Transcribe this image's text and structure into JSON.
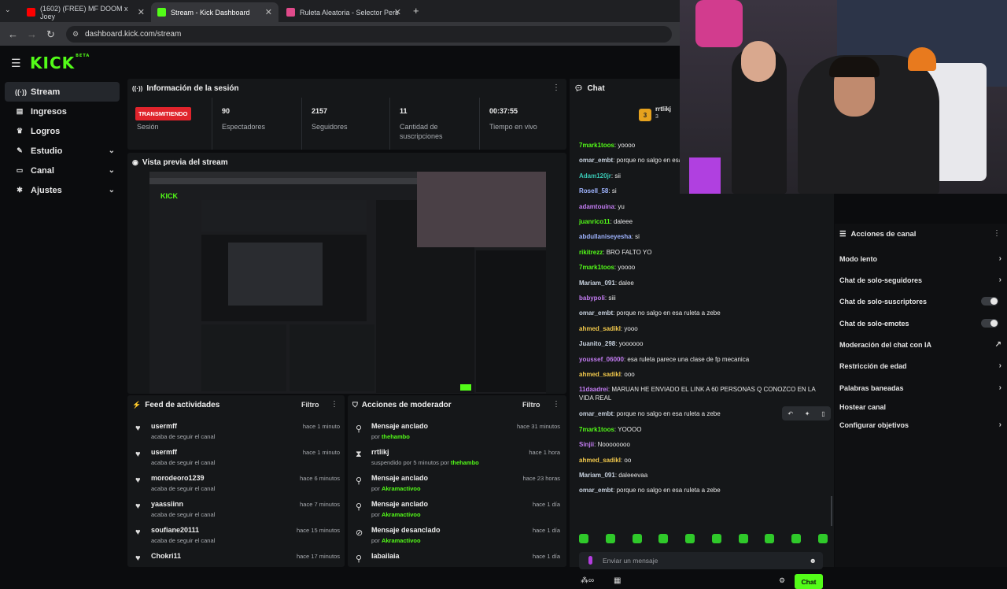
{
  "browser": {
    "tabs": [
      {
        "title": "(1602) (FREE) MF DOOM x Joey",
        "favicon_color": "#ff0000"
      },
      {
        "title": "Stream - Kick Dashboard",
        "favicon_color": "#53fc18"
      },
      {
        "title": "Ruleta Aleatoria - Selector Pers",
        "favicon_color": "#e04a8a"
      }
    ],
    "url": "dashboard.kick.com/stream",
    "new_tab": "+"
  },
  "logo": {
    "text": "KICK",
    "beta": "BETA"
  },
  "sidebar": {
    "items": [
      {
        "label": "Stream",
        "icon": "broadcast-icon",
        "glyph": "((·))",
        "chevron": false
      },
      {
        "label": "Ingresos",
        "icon": "revenue-icon",
        "glyph": "▤",
        "chevron": false
      },
      {
        "label": "Logros",
        "icon": "trophy-icon",
        "glyph": "♛",
        "chevron": false
      },
      {
        "label": "Estudio",
        "icon": "studio-icon",
        "glyph": "✎",
        "chevron": true
      },
      {
        "label": "Canal",
        "icon": "channel-icon",
        "glyph": "▭",
        "chevron": true
      },
      {
        "label": "Ajustes",
        "icon": "gear-icon",
        "glyph": "✱",
        "chevron": true
      }
    ]
  },
  "session": {
    "title": "Información de la sesión",
    "live_badge": "TRANSMITIENDO",
    "stats": [
      {
        "value": "",
        "label": "Sesión"
      },
      {
        "value": "90",
        "label": "Espectadores"
      },
      {
        "value": "2157",
        "label": "Seguidores"
      },
      {
        "value": "11",
        "label": "Cantidad de suscripciones"
      },
      {
        "value": "00:37:55",
        "label": "Tiempo en vivo"
      }
    ]
  },
  "preview": {
    "title": "Vista previa del stream"
  },
  "activity": {
    "title": "Feed de actividades",
    "filter": "Filtro",
    "items": [
      {
        "name": "usermff",
        "sub": "acaba de seguir el canal",
        "time": "hace 1 minuto"
      },
      {
        "name": "usermff",
        "sub": "acaba de seguir el canal",
        "time": "hace 1 minuto"
      },
      {
        "name": "morodeoro1239",
        "sub": "acaba de seguir el canal",
        "time": "hace 6 minutos"
      },
      {
        "name": "yaassiinn",
        "sub": "acaba de seguir el canal",
        "time": "hace 7 minutos"
      },
      {
        "name": "soufiane20111",
        "sub": "acaba de seguir el canal",
        "time": "hace 15 minutos"
      },
      {
        "name": "Chokri11",
        "sub": "",
        "time": "hace 17 minutos"
      }
    ]
  },
  "moderator": {
    "title": "Acciones de moderador",
    "filter": "Filtro",
    "items": [
      {
        "icon": "pin-icon",
        "glyph": "⚲",
        "action": "Mensaje anclado",
        "pre": "por ",
        "by": "thehambo",
        "time": "hace 31 minutos"
      },
      {
        "icon": "timeout-icon",
        "glyph": "⧗",
        "action": "rrtlikj",
        "pre": "suspendido por 5 minutos por ",
        "by": "thehambo",
        "time": "hace 1 hora"
      },
      {
        "icon": "pin-icon",
        "glyph": "⚲",
        "action": "Mensaje anclado",
        "pre": "por ",
        "by": "Akramactivoo",
        "time": "hace 23 horas"
      },
      {
        "icon": "pin-icon",
        "glyph": "⚲",
        "action": "Mensaje anclado",
        "pre": "por ",
        "by": "Akramactivoo",
        "time": "hace 1 día"
      },
      {
        "icon": "unpin-icon",
        "glyph": "⊘",
        "action": "Mensaje desanclado",
        "pre": "por ",
        "by": "Akramactivoo",
        "time": "hace 1 día"
      },
      {
        "icon": "pin-icon",
        "glyph": "⚲",
        "action": "labailaia",
        "pre": "",
        "by": "",
        "time": "hace 1 día"
      }
    ]
  },
  "chat": {
    "title": "Chat",
    "pinned_user": "rrtlikj",
    "pinned_count": "3",
    "messages": [
      {
        "user": "7mark1toos",
        "color": "#53fc18",
        "text": "yoooo"
      },
      {
        "user": "omar_embt",
        "color": "#c9d3e0",
        "text": "porque no salgo en esa ruleta a zebe"
      },
      {
        "user": "Adam120jr",
        "color": "#39c7b4",
        "text": "sii"
      },
      {
        "user": "Rosell_58",
        "color": "#9fb4ff",
        "text": "si"
      },
      {
        "user": "adamtouina",
        "color": "#c37cf2",
        "text": "yu"
      },
      {
        "user": "juanrico11",
        "color": "#53fc18",
        "text": "daleee"
      },
      {
        "user": "abdullaniseyesha",
        "color": "#9fb4ff",
        "text": "si"
      },
      {
        "user": "rikitrezz",
        "color": "#53fc18",
        "text": "BRO FALTO YO"
      },
      {
        "user": "7mark1toos",
        "color": "#53fc18",
        "text": "yoooo"
      },
      {
        "user": "Mariam_091",
        "color": "#c9d3e0",
        "text": "dalee"
      },
      {
        "user": "babypoli",
        "color": "#c37cf2",
        "text": "siii"
      },
      {
        "user": "omar_embt",
        "color": "#c9d3e0",
        "text": "porque no salgo en esa ruleta a zebe"
      },
      {
        "user": "ahmed_sadikl",
        "color": "#f2c94c",
        "text": "yooo"
      },
      {
        "user": "Juanito_298",
        "color": "#c9d3e0",
        "text": "yoooooo"
      },
      {
        "user": "youssef_06000",
        "color": "#c37cf2",
        "text": "esa ruleta parece una clase de fp mecanica"
      },
      {
        "user": "ahmed_sadikl",
        "color": "#f2c94c",
        "text": "ooo"
      },
      {
        "user": "11daadrei",
        "color": "#c37cf2",
        "text": "MARUAN HE ENVIADO EL LINK A 60 PERSONAS Q CONOZCO EN LA VIDA REAL"
      },
      {
        "user": "omar_embt",
        "color": "#c9d3e0",
        "text": "porque no salgo en esa ruleta a zebe"
      },
      {
        "user": "7mark1toos",
        "color": "#53fc18",
        "text": "YOOOO"
      },
      {
        "user": "Sinjii",
        "color": "#c37cf2",
        "text": "Noooooooo"
      },
      {
        "user": "ahmed_sadikl",
        "color": "#f2c94c",
        "text": "oo"
      },
      {
        "user": "Mariam_091",
        "color": "#c9d3e0",
        "text": "daleeevaa"
      },
      {
        "user": "omar_embt",
        "color": "#c9d3e0",
        "text": "porque no salgo en esa ruleta a zebe"
      }
    ],
    "input_placeholder": "Enviar un mensaje",
    "send_label": "Chat"
  },
  "channel_actions": {
    "title": "Acciones de canal",
    "items": [
      {
        "label": "Modo lento",
        "control": "chevron"
      },
      {
        "label": "Chat de solo-seguidores",
        "control": "chevron"
      },
      {
        "label": "Chat de solo-suscriptores",
        "control": "toggle"
      },
      {
        "label": "Chat de solo-emotes",
        "control": "toggle"
      },
      {
        "label": "Moderación del chat con IA",
        "control": "external"
      },
      {
        "label": "Restricción de edad",
        "control": "chevron"
      },
      {
        "label": "Palabras baneadas",
        "control": "chevron"
      },
      {
        "label": "Hostear canal",
        "control": "none"
      },
      {
        "label": "Configurar objetivos",
        "control": "chevron"
      }
    ]
  },
  "colors": {
    "accent": "#53fc18",
    "live": "#e0242c",
    "panel": "#151719",
    "bg": "#0b0c0e"
  }
}
